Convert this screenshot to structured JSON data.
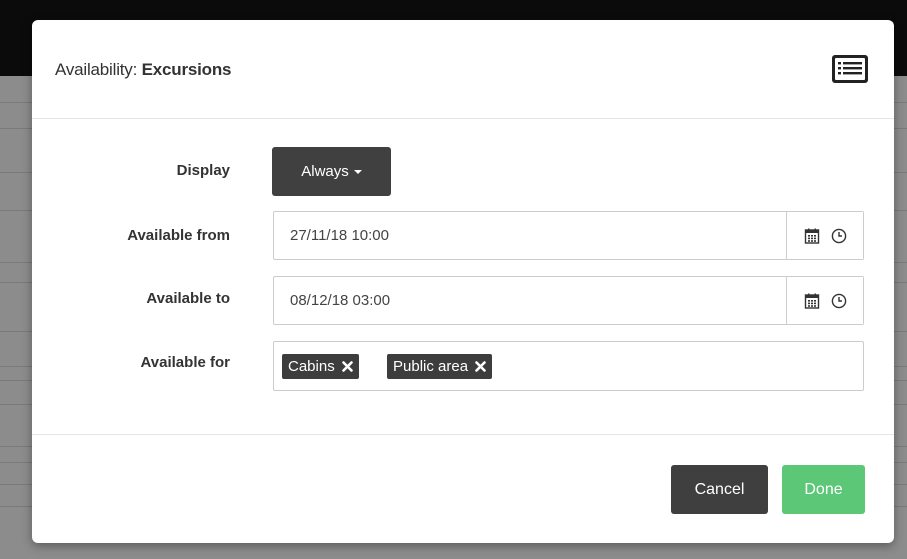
{
  "modal": {
    "title_prefix": "Availability: ",
    "title_name": "Excursions",
    "header_icon": "list-icon"
  },
  "form": {
    "display": {
      "label": "Display",
      "value": "Always"
    },
    "available_from": {
      "label": "Available from",
      "value": "27/11/18 10:00"
    },
    "available_to": {
      "label": "Available to",
      "value": "08/12/18 03:00"
    },
    "available_for": {
      "label": "Available for",
      "tags": [
        "Cabins",
        "Public area"
      ]
    }
  },
  "footer": {
    "cancel_label": "Cancel",
    "done_label": "Done"
  },
  "colors": {
    "primary_dark": "#404040",
    "success": "#5cc777"
  }
}
